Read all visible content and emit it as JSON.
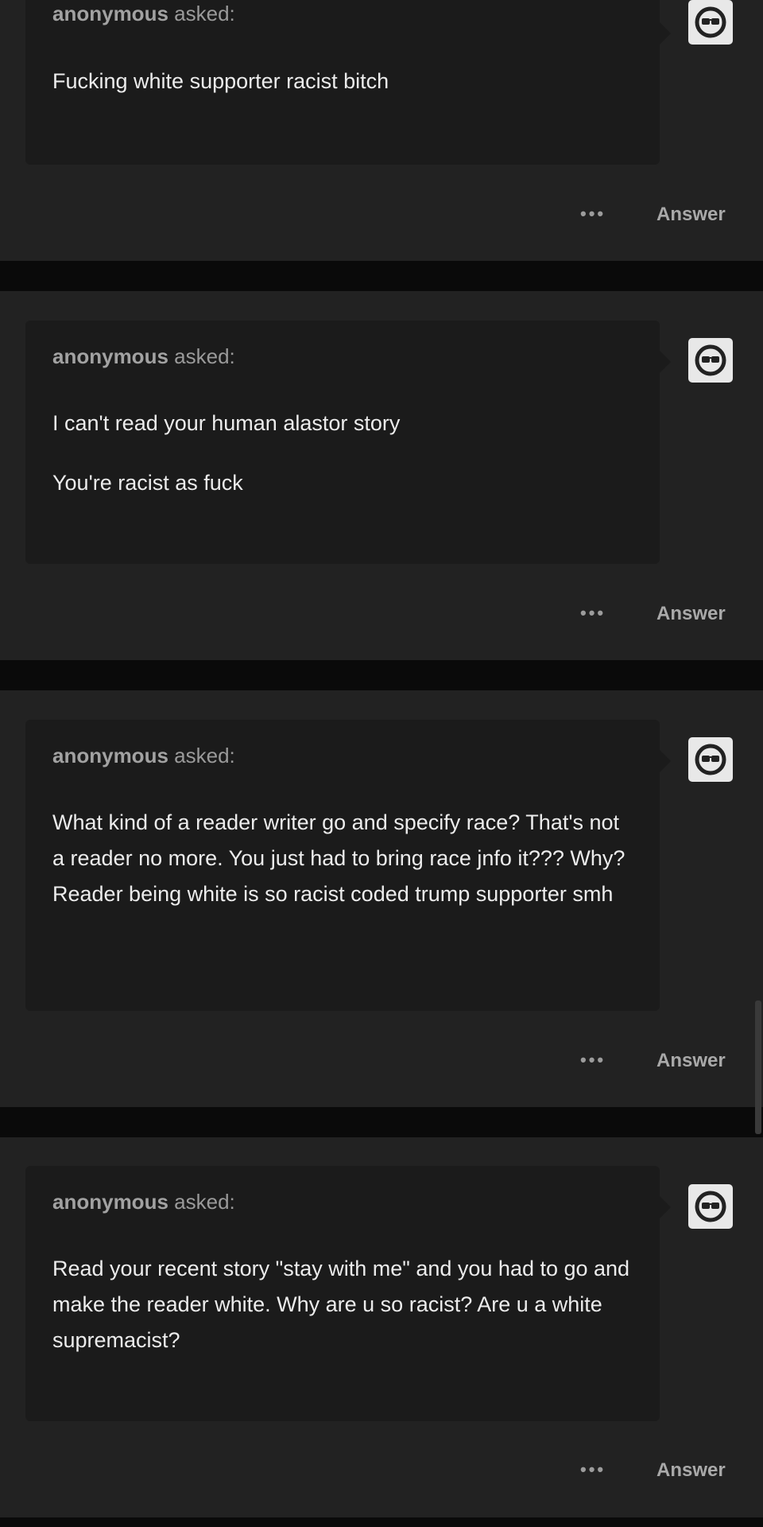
{
  "posts": [
    {
      "asker_name": "anonymous",
      "asker_suffix": " asked:",
      "paragraphs": [
        "Fucking white supporter racist bitch"
      ],
      "answer_label": "Answer"
    },
    {
      "asker_name": "anonymous",
      "asker_suffix": " asked:",
      "paragraphs": [
        "I can't read your human alastor story",
        "You're racist as fuck"
      ],
      "answer_label": "Answer"
    },
    {
      "asker_name": "anonymous",
      "asker_suffix": " asked:",
      "paragraphs": [
        "What kind of a reader writer go and specify race? That's not a reader no more. You just had to bring race jnfo it??? Why? Reader being white is so racist coded trump supporter smh"
      ],
      "answer_label": "Answer"
    },
    {
      "asker_name": "anonymous",
      "asker_suffix": " asked:",
      "paragraphs": [
        "Read your recent story \"stay with me\" and you had to go and make the reader white. Why are u so racist? Are u a white supremacist?"
      ],
      "answer_label": "Answer"
    }
  ],
  "more_icon": "ellipsis-icon",
  "avatar_icon": "sunglasses-face-icon",
  "colors": {
    "page_background": "#0a0a0a",
    "post_background": "#222222",
    "bubble_background": "#1b1b1b",
    "question_text": "#ececec",
    "secondary_text": "#9a9a9a"
  }
}
